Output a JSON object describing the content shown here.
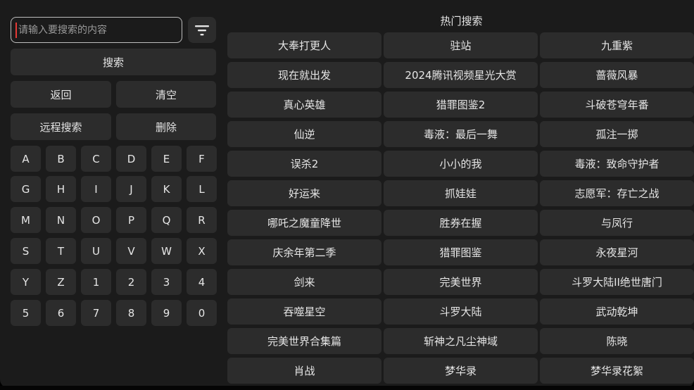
{
  "search": {
    "placeholder": "请输入要搜索的内容",
    "value": "",
    "filter_icon": "filter-lines-icon",
    "search_label": "搜索"
  },
  "actions": {
    "back_label": "返回",
    "clear_label": "清空",
    "remote_search_label": "远程搜索",
    "delete_label": "删除"
  },
  "keyboard": {
    "keys": [
      "A",
      "B",
      "C",
      "D",
      "E",
      "F",
      "G",
      "H",
      "I",
      "J",
      "K",
      "L",
      "M",
      "N",
      "O",
      "P",
      "Q",
      "R",
      "S",
      "T",
      "U",
      "V",
      "W",
      "X",
      "Y",
      "Z",
      "1",
      "2",
      "3",
      "4",
      "5",
      "6",
      "7",
      "8",
      "9",
      "0"
    ]
  },
  "hot": {
    "title": "热门搜索",
    "items": [
      "大奉打更人",
      "驻站",
      "九重紫",
      "现在就出发",
      "2024腾讯视频星光大赏",
      "蔷薇风暴",
      "真心英雄",
      "猎罪图鉴2",
      "斗破苍穹年番",
      "仙逆",
      "毒液：最后一舞",
      "孤注一掷",
      "误杀2",
      "小小的我",
      "毒液：致命守护者",
      "好运来",
      "抓娃娃",
      "志愿军：存亡之战",
      "哪吒之魔童降世",
      "胜券在握",
      "与凤行",
      "庆余年第二季",
      "猎罪图鉴",
      "永夜星河",
      "剑来",
      "完美世界",
      "斗罗大陆II绝世唐门",
      "吞噬星空",
      "斗罗大陆",
      "武动乾坤",
      "完美世界合集篇",
      "斩神之凡尘神域",
      "陈晓",
      "肖战",
      "梦华录",
      "梦华录花絮"
    ]
  },
  "colors": {
    "background": "#1b1b1b",
    "button": "#2c2c2c",
    "text": "#e6e6e6",
    "caret": "#e53935"
  }
}
